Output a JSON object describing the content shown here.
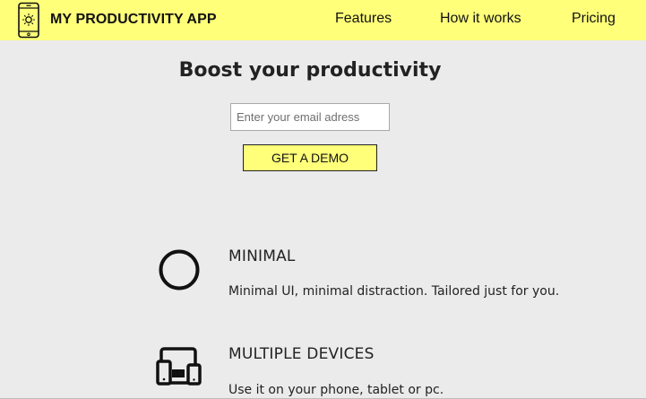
{
  "header": {
    "brand": "MY PRODUCTIVITY APP",
    "logo_icon": "phone-sun-icon",
    "nav": [
      {
        "label": "Features"
      },
      {
        "label": "How it works"
      },
      {
        "label": "Pricing"
      }
    ],
    "background_color": "#ffff7a"
  },
  "hero": {
    "title": "Boost your productivity",
    "email_placeholder": "Enter your email adress",
    "email_value": "",
    "cta_label": "GET A DEMO"
  },
  "features": [
    {
      "icon": "circle-icon",
      "title": "MINIMAL",
      "description": "Minimal UI, minimal distraction. Tailored just for you."
    },
    {
      "icon": "multiple-devices-icon",
      "title": "MULTIPLE DEVICES",
      "description": "Use it on your phone, tablet or pc."
    }
  ],
  "colors": {
    "accent": "#ffff7a",
    "page_background": "#ebebeb",
    "text": "#222222"
  }
}
